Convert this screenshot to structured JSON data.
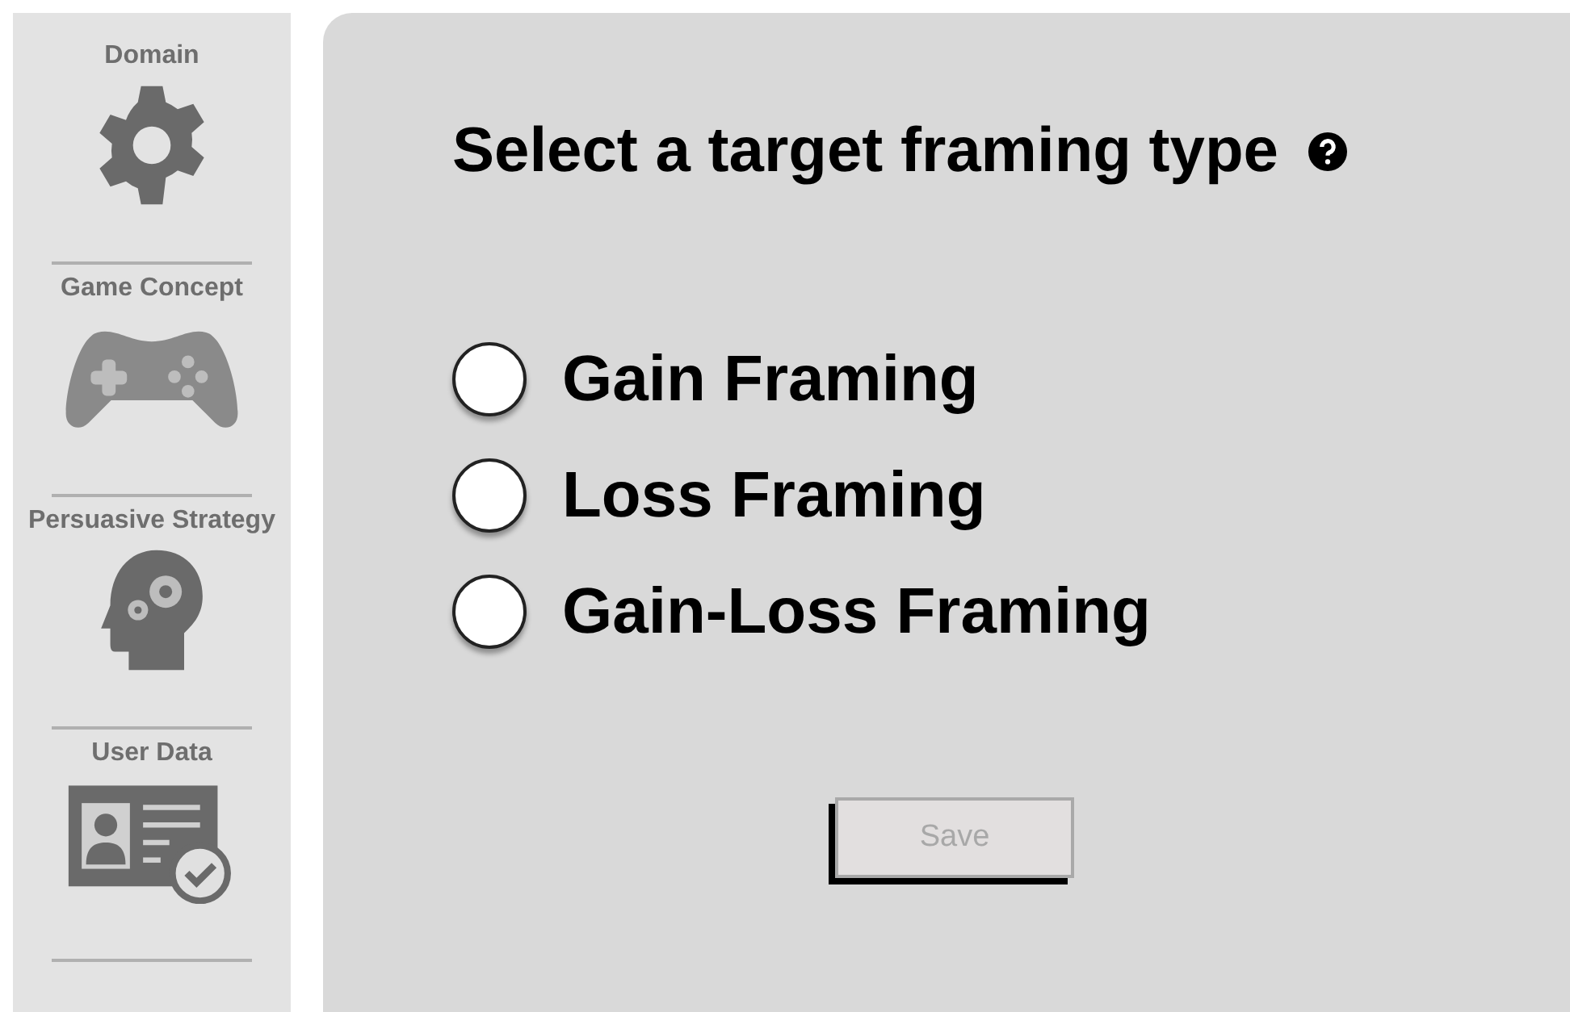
{
  "sidebar": {
    "items": [
      {
        "label": "Domain",
        "kind": "gear"
      },
      {
        "label": "Game Concept",
        "kind": "gamepad"
      },
      {
        "label": "Persuasive Strategy",
        "kind": "head"
      },
      {
        "label": "User Data",
        "kind": "card"
      }
    ]
  },
  "title": "Select a target framing type",
  "options": [
    {
      "label": "Gain Framing",
      "selected": false
    },
    {
      "label": "Loss Framing",
      "selected": false
    },
    {
      "label": "Gain-Loss Framing",
      "selected": false
    }
  ],
  "save_button": {
    "label": "Save",
    "disabled": true
  }
}
